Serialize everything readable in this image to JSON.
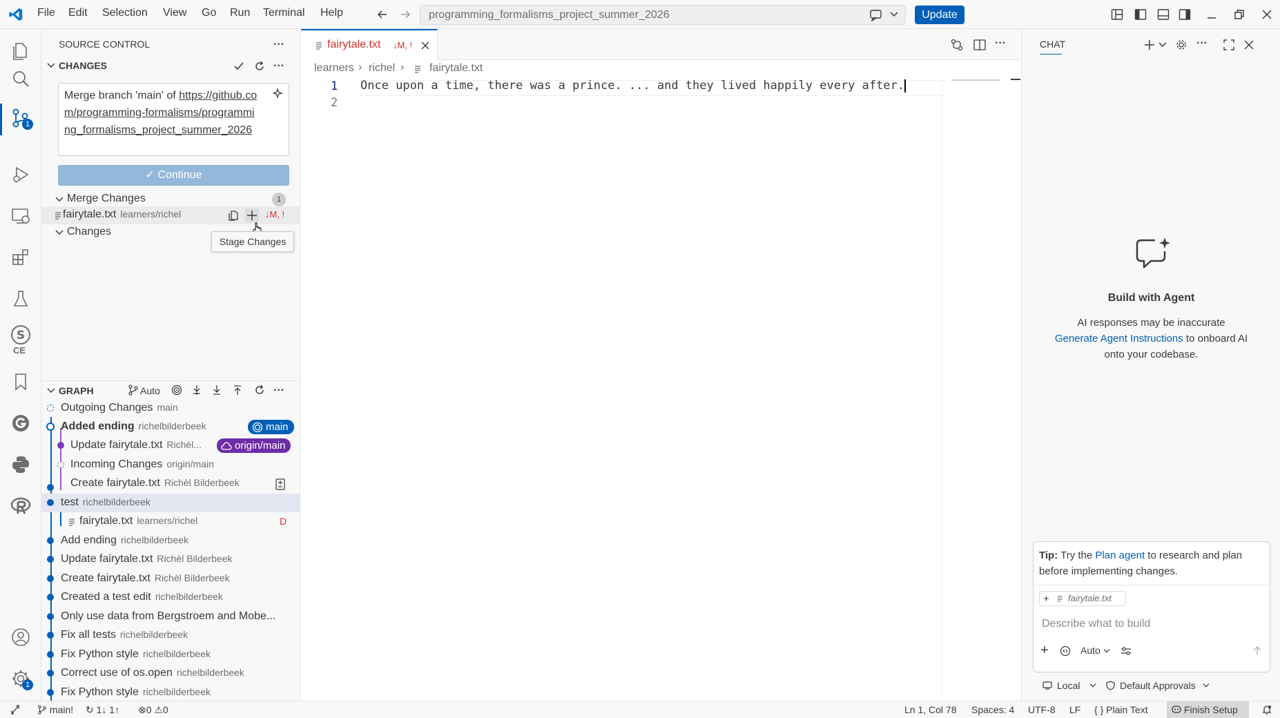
{
  "titlebar": {
    "menu": [
      "File",
      "Edit",
      "Selection",
      "View",
      "Go",
      "Run",
      "Terminal",
      "Help"
    ],
    "command_center": "programming_formalisms_project_summer_2026",
    "update_label": "Update"
  },
  "activitybar": {
    "scm_badge": "1",
    "settings_badge": "1",
    "ce_label": "CE"
  },
  "sidebar": {
    "title": "SOURCE CONTROL",
    "changes_header": "CHANGES",
    "commit_message_line1": "Merge branch 'main' of ",
    "commit_message_link": "https://github.com/programming-formalisms/programming_formalisms_project_summer_2026",
    "continue_label": "Continue",
    "merge_changes_label": "Merge Changes",
    "merge_changes_count": "1",
    "merge_file": {
      "name": "fairytale.txt",
      "path": "learners/richel",
      "status": "↓M, !"
    },
    "changes_label": "Changes",
    "tooltip": "Stage Changes"
  },
  "graph": {
    "header": "GRAPH",
    "auto_label": "Auto",
    "rows": [
      {
        "title": "Outgoing Changes",
        "desc": "main"
      },
      {
        "title": "Added ending",
        "desc": "richelbilderbeek",
        "pill": "main"
      },
      {
        "title": "Update fairytale.txt",
        "desc": "Richèl...",
        "pill": "origin/main"
      },
      {
        "title": "Incoming Changes",
        "desc": "origin/main"
      },
      {
        "title": "Create fairytale.txt",
        "desc": "Richèl Bilderbeek"
      },
      {
        "title": "test",
        "desc": "richelbilderbeek"
      },
      {
        "title": "fairytale.txt",
        "desc": "learners/richel",
        "status": "D"
      },
      {
        "title": "Add ending",
        "desc": "richelbilderbeek"
      },
      {
        "title": "Update fairytale.txt",
        "desc": "Richèl Bilderbeek"
      },
      {
        "title": "Create fairytale.txt",
        "desc": "Richèl Bilderbeek"
      },
      {
        "title": "Created a test edit",
        "desc": "richelbilderbeek"
      },
      {
        "title": "Only use data from Bergstroem and Mobe...",
        "desc": ""
      },
      {
        "title": "Fix all tests",
        "desc": "richelbilderbeek"
      },
      {
        "title": "Fix Python style",
        "desc": "richelbilderbeek"
      },
      {
        "title": "Correct use of os.open",
        "desc": "richelbilderbeek"
      },
      {
        "title": "Fix Python style",
        "desc": "richelbilderbeek"
      }
    ]
  },
  "editor": {
    "tab_name": "fairytale.txt",
    "tab_status": "↓M, !",
    "breadcrumb": [
      "learners",
      "richel",
      "fairytale.txt"
    ],
    "line_numbers": [
      "1",
      "2"
    ],
    "line1": "Once upon a time, there was a prince. ... and they lived happily every after."
  },
  "chat": {
    "title": "CHAT",
    "heading": "Build with Agent",
    "line1": "AI responses may be inaccurate",
    "link": "Generate Agent Instructions",
    "line2_rest": " to onboard AI",
    "line3": "onto your codebase.",
    "tip_bold": "Tip:",
    "tip_pre": " Try the ",
    "tip_link": "Plan agent",
    "tip_post": " to research and plan before implementing changes.",
    "attachment": "fairytale.txt",
    "placeholder": "Describe what to build",
    "mode": "Auto",
    "local": "Local",
    "approvals": "Default Approvals"
  },
  "statusbar": {
    "branch": "main!",
    "sync": "1↓ 1↑",
    "errors": "0",
    "warnings": "0",
    "position": "Ln 1, Col 78",
    "spaces": "Spaces: 4",
    "encoding": "UTF-8",
    "eol": "LF",
    "language": "Plain Text",
    "finish_setup": "Finish Setup"
  },
  "colors": {
    "accent": "#005fb8",
    "modified": "#d32f2f",
    "origin_pill": "#6f2da8"
  }
}
